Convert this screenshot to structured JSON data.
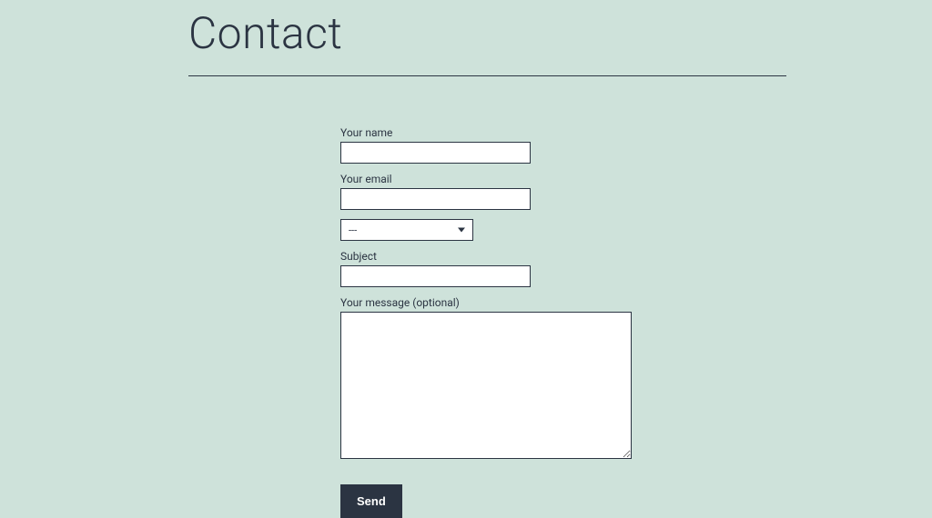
{
  "page": {
    "title": "Contact"
  },
  "form": {
    "name": {
      "label": "Your name",
      "value": ""
    },
    "email": {
      "label": "Your email",
      "value": ""
    },
    "dropdown": {
      "selected": "---"
    },
    "subject": {
      "label": "Subject",
      "value": ""
    },
    "message": {
      "label": "Your message (optional)",
      "value": ""
    },
    "submit_label": "Send"
  }
}
